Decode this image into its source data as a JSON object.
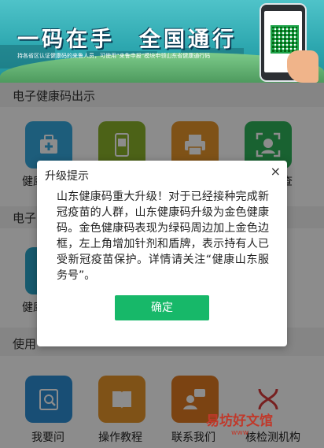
{
  "banner": {
    "title": "一码在手　全国通行",
    "subtitle": "持各省区认证健康码的来鲁人员，可使用“来鲁申报”模块申领山东省健康通行码"
  },
  "sections": [
    {
      "title": "电子健康码出示"
    },
    {
      "title": "电子"
    },
    {
      "title": "使用"
    }
  ],
  "apps_row1": [
    {
      "label": "健康",
      "icon": "medkit-icon",
      "color": "#36a9e1"
    },
    {
      "label": "",
      "icon": "phone-code-icon",
      "color": "#8ab22b"
    },
    {
      "label": "",
      "icon": "printer-icon",
      "color": "#e8962b"
    },
    {
      "label": "查",
      "icon": "face-scan-icon",
      "color": "#2fb35a"
    }
  ],
  "apps_row2": [
    {
      "label": "健康",
      "icon": "card-icon",
      "color": "#2aa4c9"
    }
  ],
  "apps_row3": [
    {
      "label": "我要问",
      "icon": "question-doc-icon",
      "color": "#2c8fd6"
    },
    {
      "label": "操作教程",
      "icon": "book-icon",
      "color": "#e8962b"
    },
    {
      "label": "联系我们",
      "icon": "contact-icon",
      "color": "#e07b22"
    },
    {
      "label": "核检测机构",
      "icon": "dna-icon",
      "color": "#d93b3b"
    }
  ],
  "modal": {
    "title": "升级提示",
    "close": "×",
    "body": "山东健康码重大升级！对于已经接种完成新冠疫苗的人群，山东健康码升级为金色健康码。金色健康码表现为绿码周边加上金色边框，左上角增加针剂和盾牌，表示持有人已受新冠疫苗保护。详情请关注“健康山东服务号”。",
    "confirm": "确定"
  },
  "watermark": {
    "text": "易坊好文馆",
    "url": "www"
  }
}
